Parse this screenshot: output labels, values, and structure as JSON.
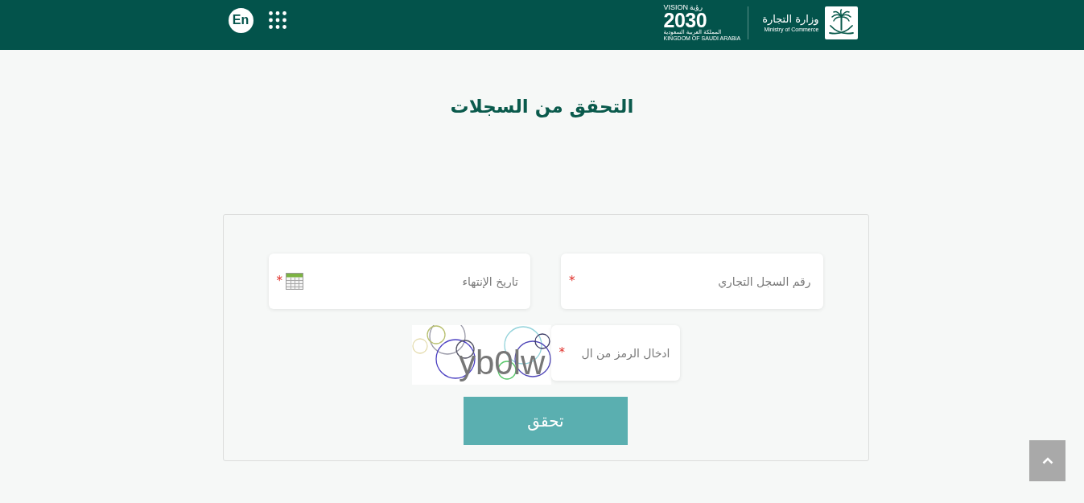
{
  "header": {
    "language_button": "En",
    "vision_logo": {
      "word_en": "VISION",
      "word_ar": "رؤية",
      "year": "2030",
      "country_ar": "المملكة العربية السعودية",
      "country_en": "KINGDOM OF SAUDI ARABIA"
    },
    "ministry_logo": {
      "name_ar": "وزارة التجارة",
      "name_en": "Ministry of Commerce"
    }
  },
  "title": "التحقق من السجلات",
  "form": {
    "fields": [
      {
        "kind": "text",
        "placeholder": "رقم السجل التجاري",
        "required_mark": "*"
      },
      {
        "kind": "date",
        "placeholder": "تاريخ الإنتهاء",
        "required_mark": "*"
      }
    ],
    "captcha": {
      "code": "yb0lw",
      "placeholder": "ادخال الرمز من ال",
      "required_mark": "*"
    },
    "submit_button": "تحقق"
  }
}
